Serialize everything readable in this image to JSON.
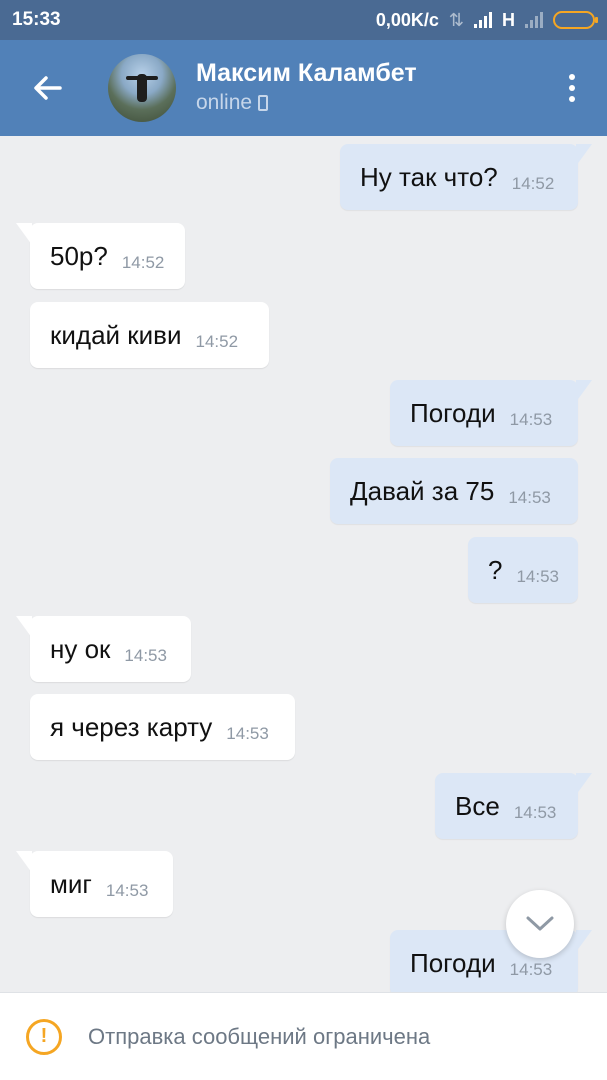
{
  "status_bar": {
    "time": "15:33",
    "net_speed": "0,00K/с",
    "network_type": "H",
    "icons": [
      "data-transfer-icon",
      "signal-icon",
      "signal-weak-icon",
      "battery-icon"
    ],
    "battery_color": "#f5a623"
  },
  "header": {
    "contact_name": "Максим Каламбет",
    "status": "online",
    "status_icon": "phone-icon",
    "back_icon": "arrow-left-icon",
    "menu_icon": "more-vertical-icon",
    "background": "#5181b8"
  },
  "messages": [
    {
      "dir": "out",
      "text": "Ну так что?",
      "time": "14:52"
    },
    {
      "dir": "in",
      "text": "50р?",
      "time": "14:52"
    },
    {
      "dir": "in",
      "text": "кидай киви",
      "time": "14:52"
    },
    {
      "dir": "out",
      "text": "Погоди",
      "time": "14:53"
    },
    {
      "dir": "out",
      "text": "Давай за 75",
      "time": "14:53"
    },
    {
      "dir": "out",
      "text": "?",
      "time": "14:53"
    },
    {
      "dir": "in",
      "text": "ну ок",
      "time": "14:53"
    },
    {
      "dir": "in",
      "text": "я через карту",
      "time": "14:53"
    },
    {
      "dir": "out",
      "text": "Все",
      "time": "14:53"
    },
    {
      "dir": "in",
      "text": "миг",
      "time": "14:53"
    },
    {
      "dir": "out",
      "text": "Погоди",
      "time": "14:53"
    }
  ],
  "scroll_down_icon": "chevron-down-icon",
  "bottom_bar": {
    "icon": "warning-icon",
    "text": "Отправка сообщений ограничена",
    "icon_color": "#f5a623"
  },
  "colors": {
    "incoming_bubble": "#ffffff",
    "outgoing_bubble": "#dce7f6",
    "background": "#edeef0"
  }
}
